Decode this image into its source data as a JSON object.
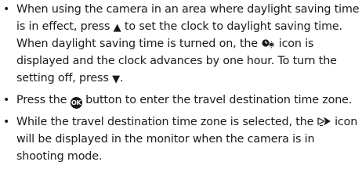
{
  "bullets": [
    {
      "t1": "When using the camera in an area where daylight saving time is in effect, press",
      "up_glyph": "▲",
      "t2": "to set the clock to daylight saving time. When daylight saving time is turned on, the",
      "t3": "icon is displayed and the clock advances by one hour. To turn the setting off, press",
      "down_glyph": "▼",
      "t4": "."
    },
    {
      "t1": "Press the",
      "ok_label": "OK",
      "t2": "button to enter the travel destination time zone."
    },
    {
      "t1": "While the travel destination time zone is selected, the",
      "t2": "icon will be displayed in the monitor when the camera is in shooting mode."
    }
  ],
  "icons": {
    "daylight_saving": "daylight-saving-icon",
    "travel_destination": "travel-destination-icon",
    "ok_button": "ok-button-icon",
    "up": "up-arrow-icon",
    "down": "down-arrow-icon"
  }
}
